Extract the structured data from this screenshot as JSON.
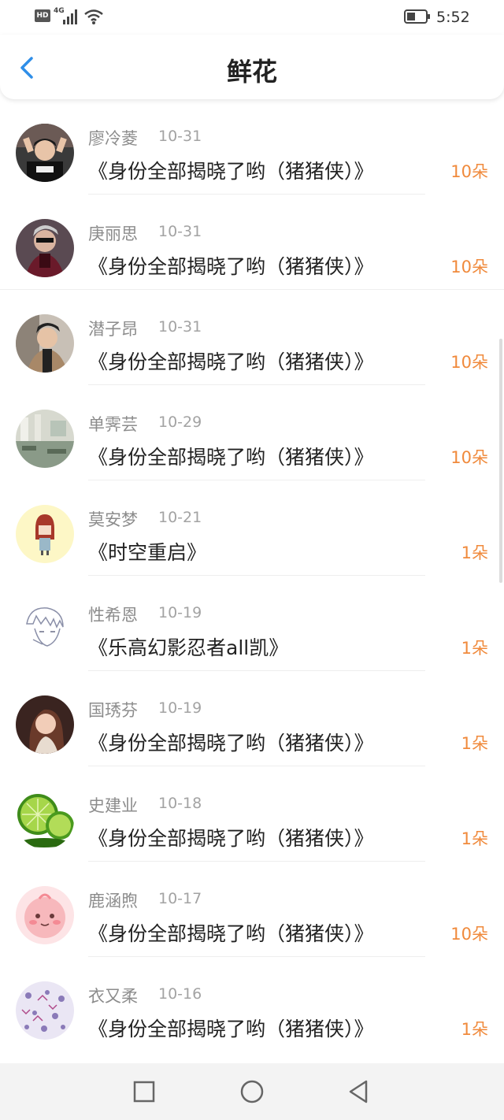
{
  "status_bar": {
    "hd": "HD",
    "network": "4G",
    "time": "5:52"
  },
  "header": {
    "title": "鲜花",
    "back_icon": "chevron-left-icon"
  },
  "list": [
    {
      "name": "廖冷菱",
      "date": "10-31",
      "book": "《身份全部揭晓了哟（猪猪侠）》",
      "amount": "10朵"
    },
    {
      "name": "庚丽思",
      "date": "10-31",
      "book": "《身份全部揭晓了哟（猪猪侠）》",
      "amount": "10朵"
    },
    {
      "name": "潜子昂",
      "date": "10-31",
      "book": "《身份全部揭晓了哟（猪猪侠）》",
      "amount": "10朵"
    },
    {
      "name": "单霁芸",
      "date": "10-29",
      "book": "《身份全部揭晓了哟（猪猪侠）》",
      "amount": "10朵"
    },
    {
      "name": "莫安梦",
      "date": "10-21",
      "book": "《时空重启》",
      "amount": "1朵"
    },
    {
      "name": "性希恩",
      "date": "10-19",
      "book": "《乐高幻影忍者all凯》",
      "amount": "1朵"
    },
    {
      "name": "国琇芬",
      "date": "10-19",
      "book": "《身份全部揭晓了哟（猪猪侠）》",
      "amount": "1朵"
    },
    {
      "name": "史建业",
      "date": "10-18",
      "book": "《身份全部揭晓了哟（猪猪侠）》",
      "amount": "1朵"
    },
    {
      "name": "鹿涵煦",
      "date": "10-17",
      "book": "《身份全部揭晓了哟（猪猪侠）》",
      "amount": "10朵"
    },
    {
      "name": "衣又柔",
      "date": "10-16",
      "book": "《身份全部揭晓了哟（猪猪侠）》",
      "amount": "1朵"
    }
  ],
  "nav_bar": {
    "recents_icon": "square-icon",
    "home_icon": "circle-icon",
    "back_icon": "triangle-back-icon"
  },
  "colors": {
    "accent": "#2f8ee8",
    "amount": "#f08a3c",
    "name": "#8c8c8c",
    "date": "#a3a3a3"
  }
}
